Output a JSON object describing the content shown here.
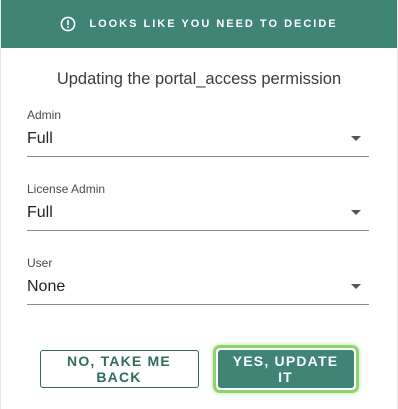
{
  "header": {
    "title": "LOOKS LIKE YOU NEED TO DECIDE",
    "icon": "exclamation-circle-icon",
    "background": "#3f8474"
  },
  "subtitle": "Updating the portal_access permission",
  "fields": [
    {
      "label": "Admin",
      "value": "Full"
    },
    {
      "label": "License Admin",
      "value": "Full"
    },
    {
      "label": "User",
      "value": "None"
    }
  ],
  "actions": {
    "back_label": "NO, TAKE ME BACK",
    "confirm_label": "YES, UPDATE IT",
    "confirm_highlight_color": "#8fd36d"
  }
}
